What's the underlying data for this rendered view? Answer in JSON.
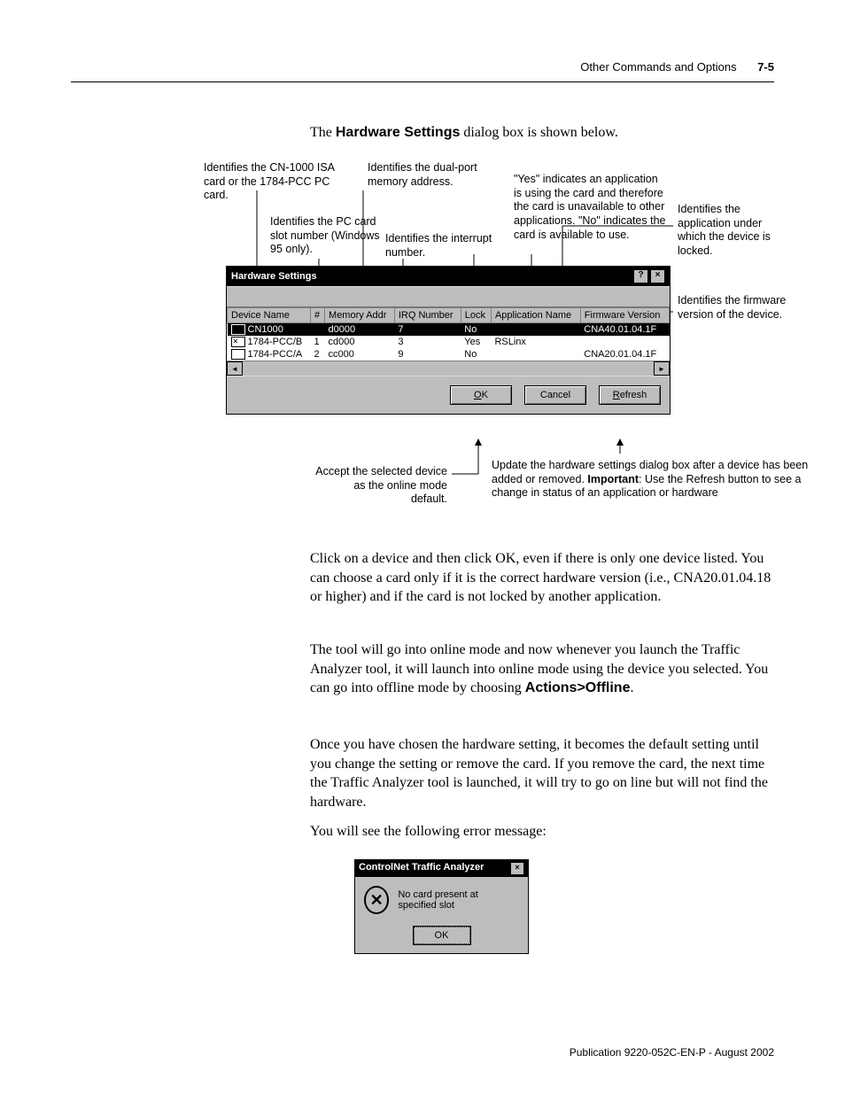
{
  "header": {
    "section": "Other Commands and Options",
    "page": "7-5"
  },
  "intro": {
    "pre": "The ",
    "bold": "Hardware Settings",
    "post": " dialog box is shown below."
  },
  "callouts": {
    "c1": "Identifies the CN-1000 ISA card or the 1784-PCC PC card.",
    "c2": "Identifies the PC card slot number (Windows 95 only).",
    "c3": "Identifies the dual-port memory address.",
    "c4": "Identifies the interrupt number.",
    "c5": "\"Yes\" indicates an application is using the card and therefore the card is unavailable to other applications. \"No\" indicates the card is available to use.",
    "c6": "Identifies the application under which the device is locked.",
    "c7": "Identifies the firmware version of the device.",
    "ok": "Accept the selected device as the online mode default.",
    "ref_a": "Update the hardware settings dialog box after a device has been added or removed. ",
    "ref_b": "Important",
    "ref_c": ": Use the Refresh button to see a change in status of an application or hardware"
  },
  "hw": {
    "title": "Hardware Settings",
    "cols": [
      "Device Name",
      "#",
      "Memory Addr",
      "IRQ Number",
      "Lock",
      "Application Name",
      "Firmware Version"
    ],
    "rows": [
      {
        "name": "CN1000",
        "slot": "",
        "mem": "d0000",
        "irq": "7",
        "lock": "No",
        "app": "",
        "fw": "CNA40.01.04.1F",
        "sel": true,
        "icon": "a"
      },
      {
        "name": "1784-PCC/B",
        "slot": "1",
        "mem": "cd000",
        "irq": "3",
        "lock": "Yes",
        "app": "RSLinx",
        "fw": "",
        "sel": false,
        "icon": "b"
      },
      {
        "name": "1784-PCC/A",
        "slot": "2",
        "mem": "cc000",
        "irq": "9",
        "lock": "No",
        "app": "",
        "fw": "CNA20.01.04.1F",
        "sel": false,
        "icon": "a"
      }
    ],
    "buttons": {
      "ok": "OK",
      "cancel": "Cancel",
      "refresh": "Refresh"
    }
  },
  "paras": {
    "p1": "Click on a device and then click OK, even if there is only one device listed. You can choose a card only if it is the correct hardware version (i.e., CNA20.01.04.18 or higher) and if the card is not locked by another application.",
    "p2a": "The tool will go into online mode and now whenever you launch the Traffic Analyzer tool, it will launch into online mode using the device you selected. You can go into offline mode by choosing ",
    "p2b": "Actions>Offline",
    "p2c": ".",
    "p3": "Once you have chosen the hardware setting, it becomes the default setting until you change the setting or remove the card. If you remove the card, the next time the Traffic Analyzer tool is launched, it will try to go on line but will not find the hardware.",
    "p4": "You will see the following error message:"
  },
  "err": {
    "title": "ControlNet Traffic Analyzer",
    "msg": "No card present at specified slot",
    "ok": "OK"
  },
  "footer": "Publication 9220-052C-EN-P - August 2002"
}
